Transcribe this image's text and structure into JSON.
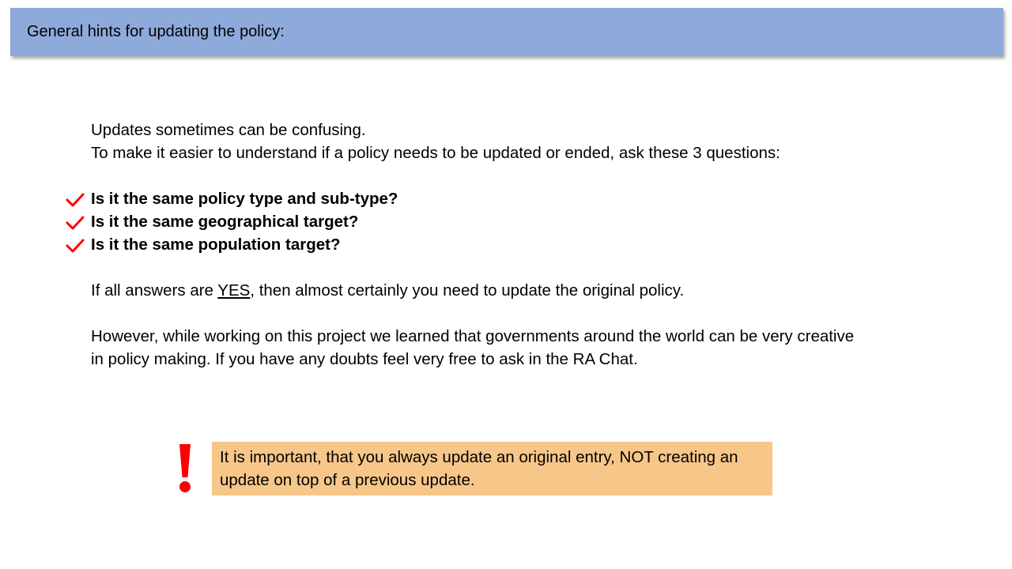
{
  "slide": {
    "title": "General hints for updating the policy:"
  },
  "intro": {
    "line1": "Updates sometimes can be confusing.",
    "line2": "To make it easier to understand if a policy needs to be updated or ended, ask these 3 questions:"
  },
  "questions": [
    "Is it the same policy type and sub-type?",
    "Is it the same geographical target?",
    "Is it the same population target?"
  ],
  "answer": {
    "before": "If all answers are ",
    "emphasis": "YES",
    "after": ", then almost certainly you need to update the original policy."
  },
  "note": {
    "line1": "However, while working on this project we learned that governments around the world can be very creative",
    "line2": "in policy making. If you have any doubts feel very free to ask in the RA Chat."
  },
  "callout": {
    "text": "It is important, that you always update an original entry, NOT creating an update on top of a previous update."
  },
  "colors": {
    "title_bar": "#8eaadb",
    "callout_bg": "#f7c689",
    "accent_red": "#ff0000"
  },
  "icons": {
    "check": "check-icon",
    "warning": "exclamation-icon"
  }
}
